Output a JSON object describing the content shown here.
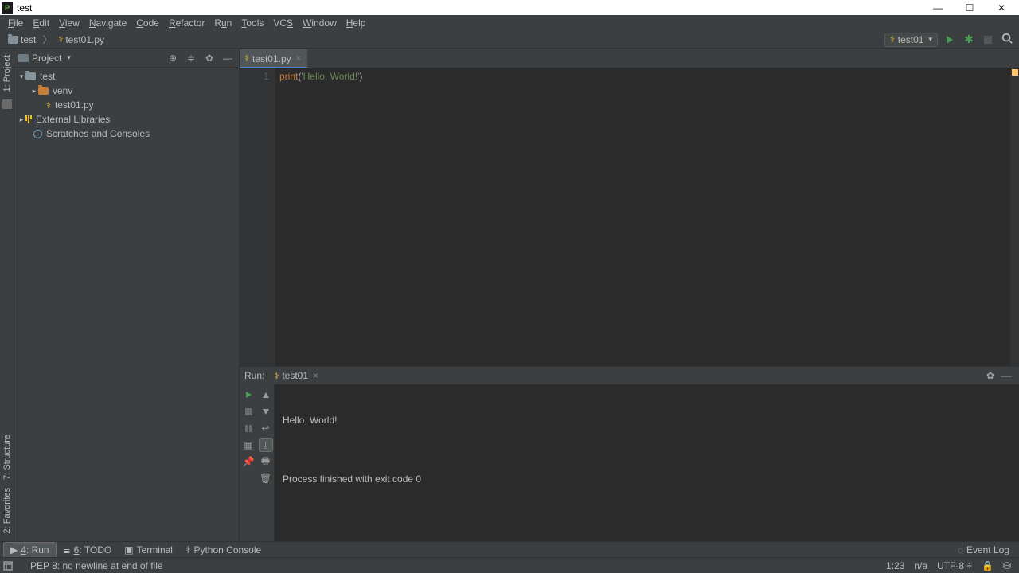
{
  "window": {
    "title": "test"
  },
  "menu": [
    "File",
    "Edit",
    "View",
    "Navigate",
    "Code",
    "Refactor",
    "Run",
    "Tools",
    "VCS",
    "Window",
    "Help"
  ],
  "breadcrumbs": [
    {
      "icon": "folder",
      "label": "test"
    },
    {
      "icon": "python",
      "label": "test01.py"
    }
  ],
  "run_config": {
    "label": "test01"
  },
  "project_label": "Project",
  "tree": {
    "root": {
      "label": "test",
      "expanded": true
    },
    "venv": {
      "label": "venv"
    },
    "file": {
      "label": "test01.py"
    },
    "ext_libs": {
      "label": "External Libraries"
    },
    "scratches": {
      "label": "Scratches and Consoles"
    }
  },
  "tab": {
    "label": "test01.py"
  },
  "editor": {
    "line_no": "1",
    "code_print": "print",
    "code_open": "(",
    "code_str": "'Hello, World!'",
    "code_close": ")"
  },
  "run_panel": {
    "title": "Run:",
    "tab": "test01",
    "output_line1": "Hello, World!",
    "output_blank": "",
    "output_line2": "Process finished with exit code 0"
  },
  "toolwindows": {
    "run": "Run",
    "todo": "TODO",
    "terminal": "Terminal",
    "python_console": "Python Console",
    "event_log": "Event Log"
  },
  "status": {
    "msg": "PEP 8: no newline at end of file",
    "pos": "1:23",
    "insp": "n/a",
    "enc": "UTF-8"
  },
  "gutter": {
    "project": "1: Project",
    "structure": "7: Structure",
    "favorites": "2: Favorites"
  }
}
